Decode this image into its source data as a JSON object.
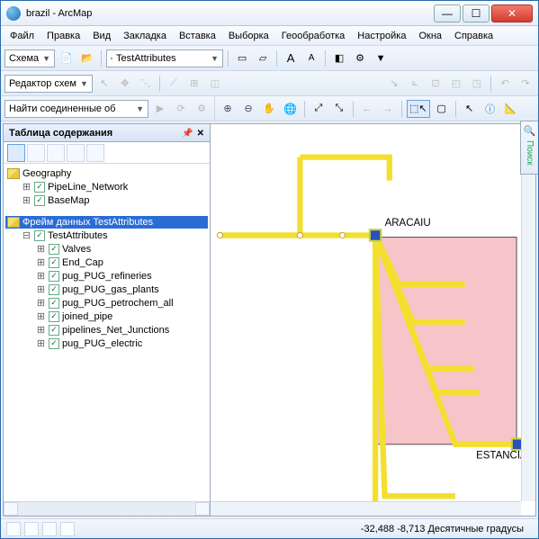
{
  "window": {
    "title": "brazil - ArcMap"
  },
  "menu": [
    "Файл",
    "Правка",
    "Вид",
    "Закладка",
    "Вставка",
    "Выборка",
    "Геообработка",
    "Настройка",
    "Окна",
    "Справка"
  ],
  "toolbar1": {
    "schema_label": "Схема",
    "combo_label": "TestAttributes"
  },
  "toolbar2": {
    "editor_label": "Редактор схем"
  },
  "toolbar3": {
    "find_label": "Найти соединенные об"
  },
  "toc": {
    "title": "Таблица содержания",
    "groups": [
      {
        "name": "Geography",
        "children": [
          "PipeLine_Network",
          "BaseMap"
        ]
      },
      {
        "name": "Фрейм данных TestAttributes",
        "selected": true,
        "children_root": "TestAttributes",
        "children": [
          "Valves",
          "End_Cap",
          "pug_PUG_refineries",
          "pug_PUG_gas_plants",
          "pug_PUG_petrochem_all",
          "joined_pipe",
          "pipelines_Net_Junctions",
          "pug_PUG_electric"
        ]
      }
    ]
  },
  "sidepanel": {
    "label": "Поиск"
  },
  "map_labels": {
    "aracaiu": "ARACAIU",
    "estancia": "ESTANCIA"
  },
  "status": {
    "coords": "-32,488  -8,713 Десятичные градусы"
  }
}
